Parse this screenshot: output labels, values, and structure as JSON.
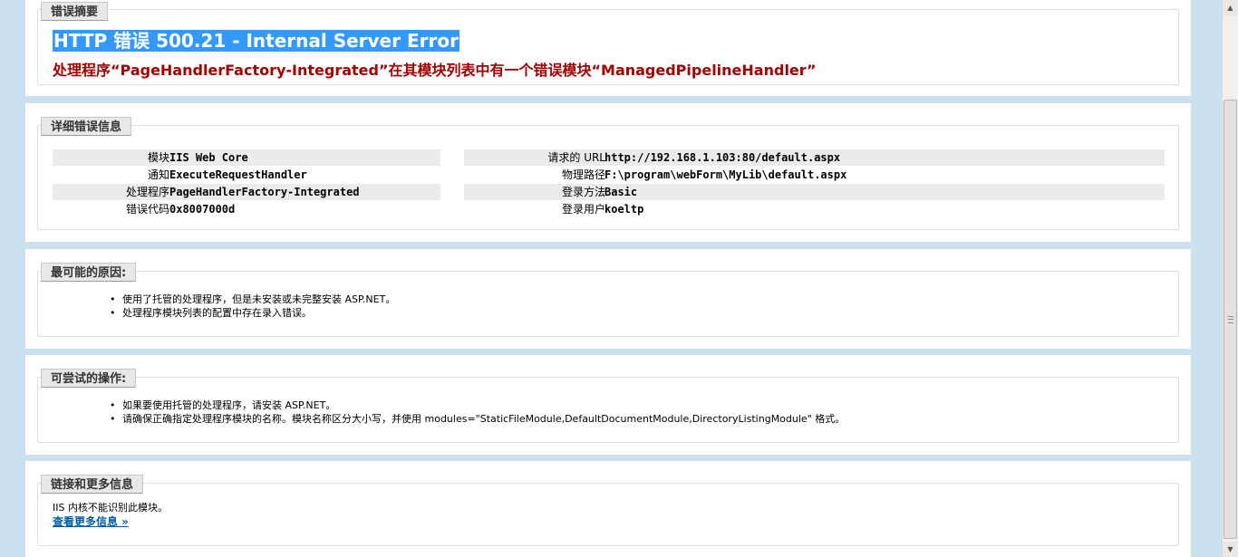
{
  "summary": {
    "legend": "错误摘要",
    "title": "HTTP 错误 500.21 - Internal Server Error",
    "message": "处理程序“PageHandlerFactory-Integrated”在其模块列表中有一个错误模块“ManagedPipelineHandler”"
  },
  "details": {
    "legend": "详细错误信息",
    "left": [
      {
        "label": "模块",
        "value": "IIS Web Core"
      },
      {
        "label": "通知",
        "value": "ExecuteRequestHandler"
      },
      {
        "label": "处理程序",
        "value": "PageHandlerFactory-Integrated"
      },
      {
        "label": "错误代码",
        "value": "0x8007000d"
      }
    ],
    "right": [
      {
        "label": "请求的 URL",
        "value": "http://192.168.1.103:80/default.aspx"
      },
      {
        "label": "物理路径",
        "value": "F:\\program\\webForm\\MyLib\\default.aspx"
      },
      {
        "label": "登录方法",
        "value": "Basic"
      },
      {
        "label": "登录用户",
        "value": "koeltp"
      }
    ]
  },
  "causes": {
    "legend": "最可能的原因:",
    "items": [
      "使用了托管的处理程序，但是未安装或未完整安装 ASP.NET。",
      "处理程序模块列表的配置中存在录入错误。"
    ]
  },
  "actions": {
    "legend": "可尝试的操作:",
    "items": [
      "如果要使用托管的处理程序，请安装 ASP.NET。",
      "请确保正确指定处理程序模块的名称。模块名称区分大小写，并使用 modules=\"StaticFileModule,DefaultDocumentModule,DirectoryListingModule\" 格式。"
    ]
  },
  "links": {
    "legend": "链接和更多信息",
    "text": "IIS 内核不能识别此模块。",
    "more_label": "查看更多信息 »"
  },
  "colors": {
    "title_highlight": "#3399ff",
    "error_red": "#a40000",
    "link": "#005ea6",
    "page_background": "#cbe1ef"
  }
}
